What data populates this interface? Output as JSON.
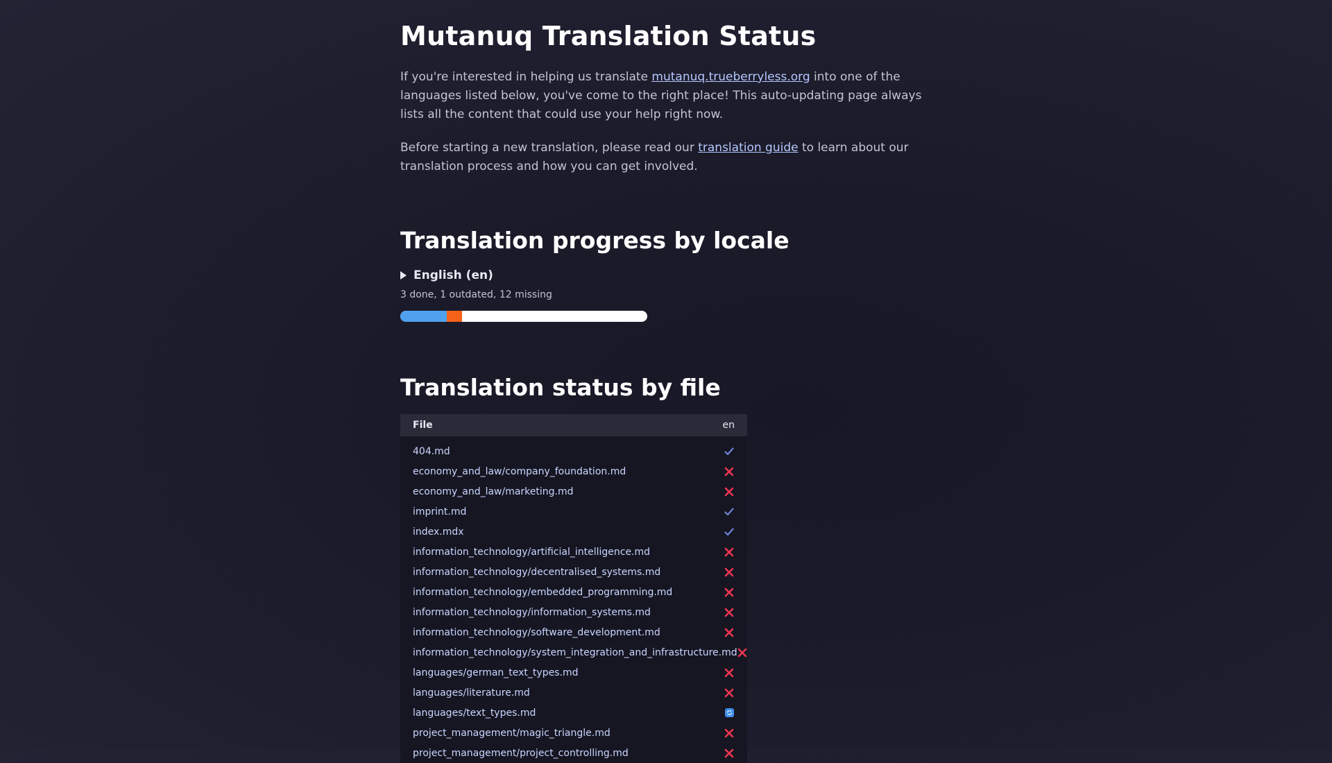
{
  "page": {
    "title": "Mutanuq Translation Status",
    "intro1": {
      "before": "If you're interested in helping us translate ",
      "link": "mutanuq.trueberryless.org",
      "after": " into one of the languages listed below, you've come to the right place! This auto-updating page always lists all the content that could use your help right now."
    },
    "intro2": {
      "before": "Before starting a new translation, please read our ",
      "link": "translation guide",
      "after": " to learn about our translation process and how you can get involved."
    }
  },
  "progress_section": {
    "heading": "Translation progress by locale",
    "locales": [
      {
        "name": "English (en)",
        "counts_text": "3 done, 1 outdated, 12 missing",
        "done": 3,
        "outdated": 1,
        "missing": 12,
        "colors": {
          "done": "#4fa1ee",
          "outdated": "#f4621a",
          "missing": "#ffffff"
        }
      }
    ]
  },
  "file_section": {
    "heading": "Translation status by file",
    "columns": {
      "file": "File",
      "locale": "en"
    },
    "rows": [
      {
        "file": "404.md",
        "status": "done"
      },
      {
        "file": "economy_and_law/company_foundation.md",
        "status": "missing"
      },
      {
        "file": "economy_and_law/marketing.md",
        "status": "missing"
      },
      {
        "file": "imprint.md",
        "status": "done"
      },
      {
        "file": "index.mdx",
        "status": "done"
      },
      {
        "file": "information_technology/artificial_intelligence.md",
        "status": "missing"
      },
      {
        "file": "information_technology/decentralised_systems.md",
        "status": "missing"
      },
      {
        "file": "information_technology/embedded_programming.md",
        "status": "missing"
      },
      {
        "file": "information_technology/information_systems.md",
        "status": "missing"
      },
      {
        "file": "information_technology/software_development.md",
        "status": "missing"
      },
      {
        "file": "information_technology/system_integration_and_infrastructure.md",
        "status": "missing"
      },
      {
        "file": "languages/german_text_types.md",
        "status": "missing"
      },
      {
        "file": "languages/literature.md",
        "status": "missing"
      },
      {
        "file": "languages/text_types.md",
        "status": "outdated"
      },
      {
        "file": "project_management/magic_triangle.md",
        "status": "missing"
      },
      {
        "file": "project_management/project_controlling.md",
        "status": "missing"
      }
    ],
    "status_icons": {
      "done": "check-icon",
      "missing": "cross-icon",
      "outdated": "outdated-icon"
    },
    "status_colors": {
      "done": "#6f84d6",
      "missing": "#ee3552",
      "outdated": "#3f8fe8"
    }
  }
}
